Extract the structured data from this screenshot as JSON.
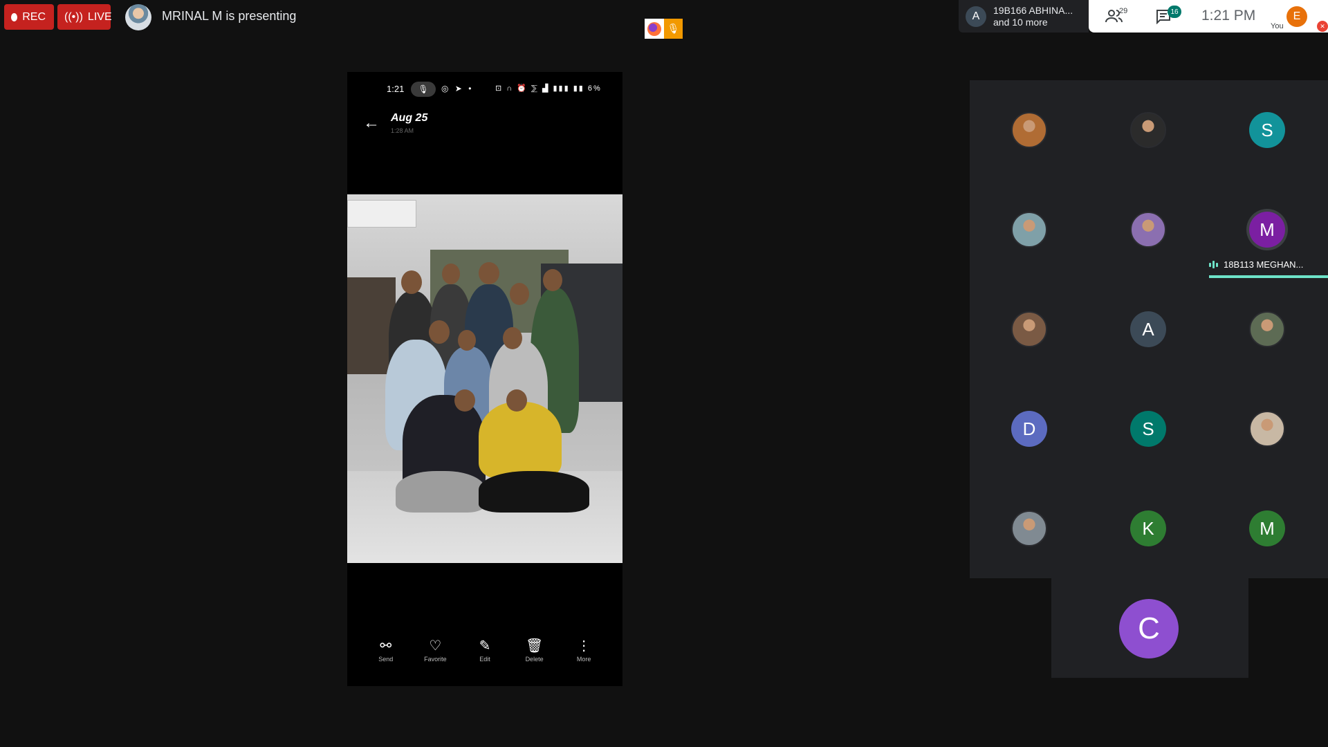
{
  "top_bar": {
    "rec_label": "REC",
    "live_label": "LIVE",
    "presenter_text": "MRINAL M is presenting"
  },
  "participants_popup": {
    "avatar_initial": "A",
    "line1": "19B166 ABHINA...",
    "line2": "and 10 more"
  },
  "top_right": {
    "people_count": "29",
    "chat_count": "16",
    "time": "1:21 PM",
    "self_initial": "E",
    "self_label": "You",
    "colors": {
      "self_avatar": "#e8710a",
      "chat_badge": "#00796b"
    }
  },
  "phone": {
    "status_time": "1:21",
    "status_icons_right": "⊡ ∩ ⏰ ⅀ ▟ ▮▮▮ ▮▮ 6%",
    "date_title": "Aug 25",
    "subtime": "1:28 AM",
    "actions": [
      {
        "label": "Send",
        "icon": "share-icon"
      },
      {
        "label": "Favorite",
        "icon": "heart-icon"
      },
      {
        "label": "Edit",
        "icon": "edit-icon"
      },
      {
        "label": "Delete",
        "icon": "trash-icon"
      },
      {
        "label": "More",
        "icon": "more-icon"
      }
    ]
  },
  "grid": {
    "tiles": [
      {
        "initial": "",
        "color": "#b06c34",
        "kind": "photo"
      },
      {
        "initial": "",
        "color": "#2b2b2b",
        "kind": "photo"
      },
      {
        "initial": "S",
        "color": "#12939a",
        "kind": "letter"
      },
      {
        "initial": "",
        "color": "#7fa0a8",
        "kind": "photo"
      },
      {
        "initial": "",
        "color": "#8b6fb0",
        "kind": "photo"
      },
      {
        "initial": "M",
        "color": "#7b1fa2",
        "kind": "letter"
      },
      {
        "initial": "",
        "color": "#7a5a44",
        "kind": "photo"
      },
      {
        "initial": "A",
        "color": "#3c4a57",
        "kind": "letter"
      },
      {
        "initial": "",
        "color": "#5d6b54",
        "kind": "photo"
      },
      {
        "initial": "D",
        "color": "#5c6bc0",
        "kind": "letter"
      },
      {
        "initial": "S",
        "color": "#00796b",
        "kind": "letter"
      },
      {
        "initial": "",
        "color": "#c8b8a4",
        "kind": "photo"
      },
      {
        "initial": "",
        "color": "#808a92",
        "kind": "photo"
      },
      {
        "initial": "K",
        "color": "#2e7d32",
        "kind": "letter"
      },
      {
        "initial": "M",
        "color": "#2e7d32",
        "kind": "letter"
      }
    ],
    "speaker_label": "18B113 MEGHAN...",
    "extra_tile_initial": "C",
    "colors": {
      "speaking": "#6ee3c9",
      "extra_avatar": "#8e4fd0"
    }
  }
}
